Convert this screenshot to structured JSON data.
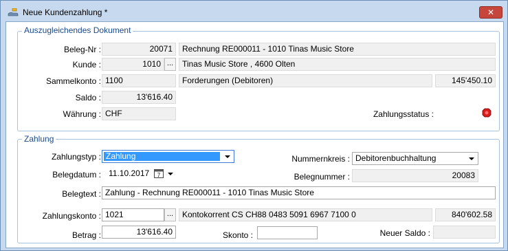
{
  "window": {
    "title": "Neue Kundenzahlung *",
    "close_label": "✕"
  },
  "section1": {
    "title": "Auszugleichendes Dokument",
    "beleg_nr": {
      "label": "Beleg-Nr :",
      "value": "20071",
      "desc": "Rechnung RE000011 - 1010 Tinas Music Store"
    },
    "kunde": {
      "label": "Kunde :",
      "value": "1010",
      "button": "...",
      "desc": "Tinas Music Store , 4600 Olten"
    },
    "sammelkonto": {
      "label": "Sammelkonto :",
      "value": "1100",
      "desc": "Forderungen (Debitoren)",
      "amount": "145'450.10"
    },
    "saldo": {
      "label": "Saldo :",
      "value": "13'616.40"
    },
    "waehrung": {
      "label": "Währung :",
      "value": "CHF"
    },
    "zahlungsstatus": {
      "label": "Zahlungsstatus :",
      "icon": "red-status-icon",
      "color": "#d81b1b"
    }
  },
  "section2": {
    "title": "Zahlung",
    "zahlungstyp": {
      "label": "Zahlungstyp :",
      "value": "Zahlung"
    },
    "nummernkreis": {
      "label": "Nummernkreis :",
      "value": "Debitorenbuchhaltung"
    },
    "belegdatum": {
      "label": "Belegdatum :",
      "value": "11.10.2017",
      "calendar_day": "7"
    },
    "belegnummer": {
      "label": "Belegnummer :",
      "value": "20083"
    },
    "belegtext": {
      "label": "Belegtext :",
      "value": "Zahlung - Rechnung RE000011 - 1010 Tinas Music Store"
    },
    "zahlungskonto": {
      "label": "Zahlungskonto :",
      "value": "1021",
      "button": "...",
      "desc": "Kontokorrent CS CH88 0483 5091 6967 7100 0",
      "amount": "840'602.58"
    },
    "betrag": {
      "label": "Betrag :",
      "value": "13'616.40"
    },
    "skonto": {
      "label": "Skonto :",
      "value": ""
    },
    "neuer_saldo": {
      "label": "Neuer Saldo :",
      "value": ""
    }
  },
  "colors": {
    "title_bar": "#c7d9ee",
    "group_title": "#1a4a8a",
    "selection": "#3399ff",
    "close": "#c7463c"
  }
}
